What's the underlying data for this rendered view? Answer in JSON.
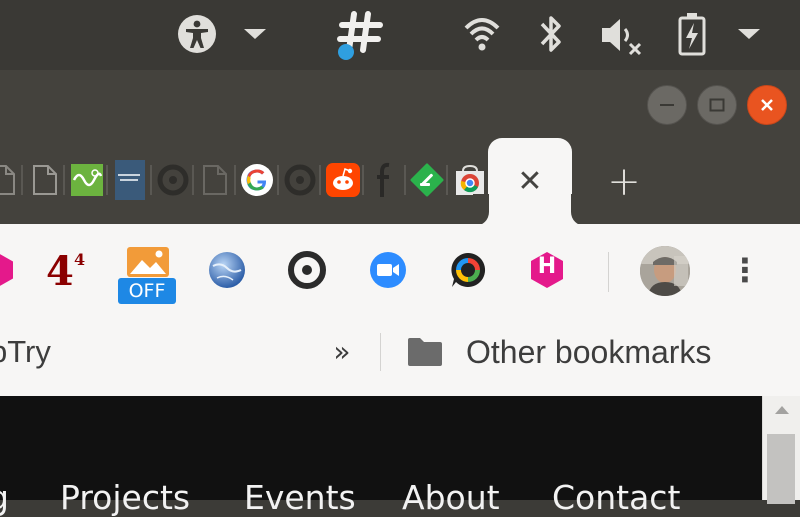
{
  "system_bar": {
    "icons": [
      "accessibility-icon",
      "chevron-down-icon",
      "slack-icon",
      "wifi-icon",
      "bluetooth-icon",
      "volume-muted-icon",
      "battery-charging-icon",
      "system-menu-chevron-icon"
    ]
  },
  "window_controls": {
    "minimize": "—",
    "maximize": "□",
    "close": "✕"
  },
  "tabs": {
    "active_close": "✕",
    "new_tab": "+"
  },
  "toolbar": {
    "ext_badge_4": "4",
    "ext_badge_4_sup": "4",
    "ext_off_label": "OFF",
    "ext_h_label": "H",
    "menu": "⋮"
  },
  "bookmarks": {
    "left_fragment": "bTry",
    "overflow": "»",
    "other_bookmarks": "Other bookmarks"
  },
  "page": {
    "nav": [
      "g",
      "Projects",
      "Events",
      "About",
      "Contact"
    ]
  },
  "colors": {
    "close_button": "#e95420",
    "topbar": "#3a3935",
    "tabstrip": "#44423d",
    "toolbar": "#f7f6f5"
  }
}
